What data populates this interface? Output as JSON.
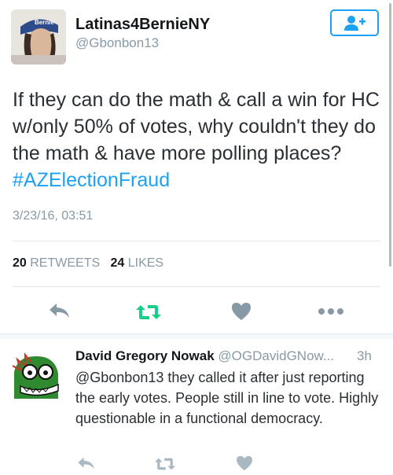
{
  "tweet": {
    "display_name": "Latinas4BernieNY",
    "handle": "@Gbonbon13",
    "text_plain": "If they can do the math & call a win for HC w/only 50% of votes, why couldn't they do the math & have more polling places? ",
    "hashtag": "#AZElectionFraud",
    "timestamp": "3/23/16, 03:51",
    "retweet_count": "20",
    "retweets_label": "RETWEETS",
    "like_count": "24",
    "likes_label": "LIKES",
    "avatar_cap_text": "Bernie"
  },
  "reply": {
    "display_name": "David Gregory Nowak",
    "handle": "@OGDavidGNow...",
    "time": "3h",
    "text": "@Gbonbon13 they called it after just reporting the early votes. People still in line to vote. Highly questionable in a functional democracy."
  },
  "icons": [
    "follow-icon",
    "reply-icon",
    "retweet-icon",
    "like-icon",
    "more-icon"
  ],
  "colors": {
    "accent": "#1da1f2",
    "retweet_green": "#19cf86",
    "muted": "#8899a6",
    "icon_gray": "#aab8c2"
  }
}
